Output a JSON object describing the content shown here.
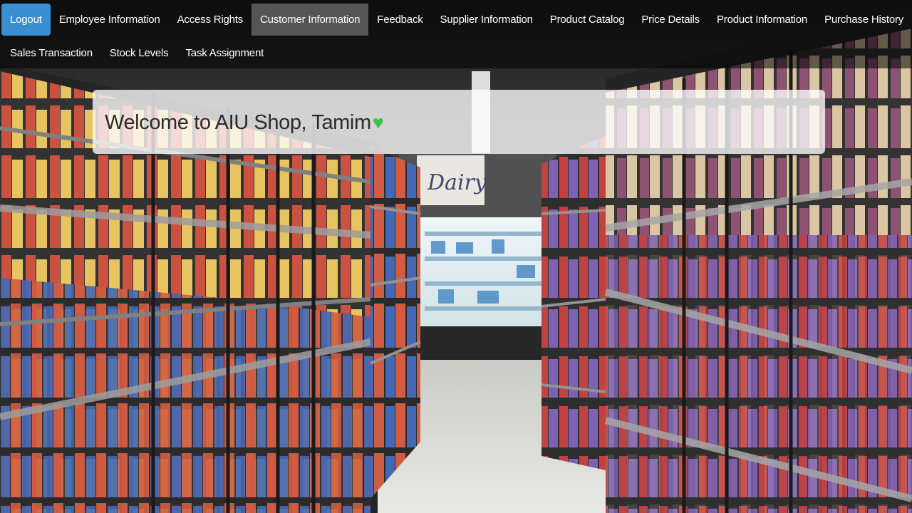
{
  "colors": {
    "logout_button": "#3a8fd0",
    "active_tab": "#6e6e6e",
    "heart": "#3cc24a",
    "banner_text": "#2b2b2b"
  },
  "nav": {
    "row1": [
      {
        "label": "Logout",
        "name": "logout-button"
      },
      {
        "label": "Employee Information",
        "name": "nav-employee-information"
      },
      {
        "label": "Access Rights",
        "name": "nav-access-rights"
      },
      {
        "label": "Customer Information",
        "name": "nav-customer-information",
        "active": true
      },
      {
        "label": "Feedback",
        "name": "nav-feedback"
      },
      {
        "label": "Supplier Information",
        "name": "nav-supplier-information"
      },
      {
        "label": "Product Catalog",
        "name": "nav-product-catalog"
      },
      {
        "label": "Price Details",
        "name": "nav-price-details"
      },
      {
        "label": "Product Information",
        "name": "nav-product-information"
      },
      {
        "label": "Purchase History",
        "name": "nav-purchase-history"
      }
    ],
    "row2": [
      {
        "label": "Sales Transaction",
        "name": "nav-sales-transaction"
      },
      {
        "label": "Stock Levels",
        "name": "nav-stock-levels"
      },
      {
        "label": "Task Assignment",
        "name": "nav-task-assignment"
      }
    ]
  },
  "welcome": {
    "text": "Welcome to AIU Shop, Tamim",
    "icon": "heart-icon",
    "heart_glyph": "♥"
  },
  "background": {
    "sign_text": "Dairy"
  }
}
